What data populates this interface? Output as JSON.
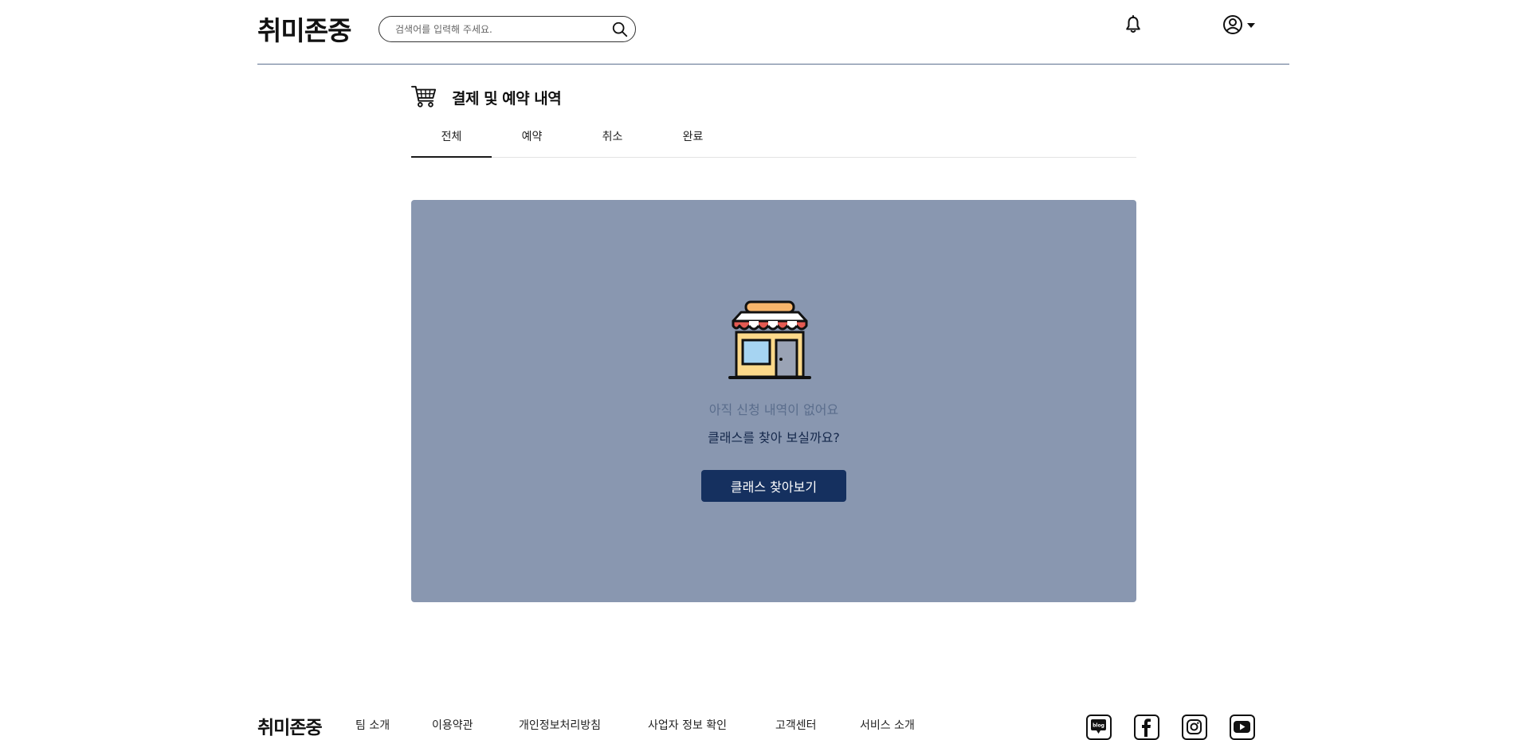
{
  "header": {
    "logo": "취미존중",
    "search": {
      "placeholder": "검색어를 입력해 주세요.",
      "value": ""
    }
  },
  "page": {
    "title": "결제 및 예약 내역",
    "tabs": [
      {
        "label": "전체",
        "active": true
      },
      {
        "label": "예약",
        "active": false
      },
      {
        "label": "취소",
        "active": false
      },
      {
        "label": "완료",
        "active": false
      }
    ]
  },
  "empty_state": {
    "message": "아직 신청 내역이 없어요",
    "prompt": "클래스를 찾아 보실까요?",
    "button_label": "클래스 찾아보기"
  },
  "footer": {
    "logo": "취미존중",
    "links": [
      "팀 소개",
      "이용약관",
      "개인정보처리방침",
      "사업자 정보 확인",
      "고객센터",
      "서비스 소개"
    ],
    "social": [
      "blog-icon",
      "facebook-icon",
      "instagram-icon",
      "youtube-icon"
    ]
  },
  "colors": {
    "accent": "#15305f",
    "panel": "#8997b0",
    "header_line": "#5c6f8e"
  }
}
